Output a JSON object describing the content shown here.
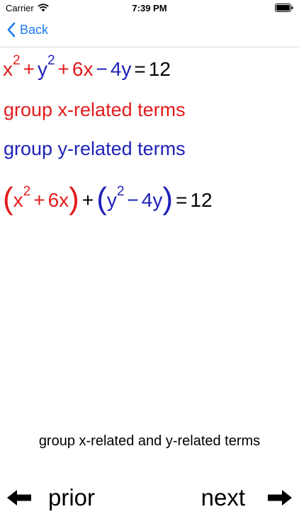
{
  "status_bar": {
    "carrier": "Carrier",
    "time": "7:39 PM"
  },
  "nav": {
    "back_label": "Back"
  },
  "equation1": {
    "x": "x",
    "x_exp": "2",
    "plus1": "+",
    "y": "y",
    "y_exp": "2",
    "plus2": "+",
    "six_x": "6x",
    "minus": "−",
    "four_y": "4y",
    "equals": "=",
    "rhs": "12"
  },
  "step_x": "group x-related terms",
  "step_y": "group y-related terms",
  "equation2": {
    "lparen1": "(",
    "x": "x",
    "x_exp": "2",
    "plus_x": "+",
    "six_x": "6x",
    "rparen1": ")",
    "plus_mid": "+",
    "lparen2": "(",
    "y": "y",
    "y_exp": "2",
    "minus_y": "−",
    "four_y": "4y",
    "rparen2": ")",
    "equals": "=",
    "rhs": "12"
  },
  "caption": "group x-related and y-related terms",
  "footer": {
    "prior_label": "prior",
    "next_label": "next"
  },
  "colors": {
    "x_terms": "#e31b1b",
    "y_terms": "#1e22b8",
    "link": "#1a7bf0"
  },
  "icons": {
    "back": "chevron-left-icon",
    "prior": "arrow-left-icon",
    "next": "arrow-right-icon"
  }
}
